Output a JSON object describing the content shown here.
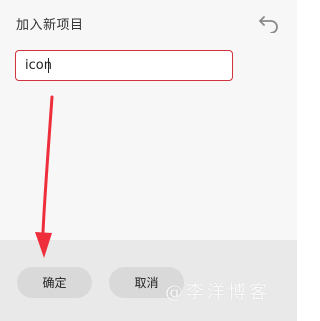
{
  "dialog": {
    "title": "加入新项目",
    "undo_icon": "undo-icon",
    "input_value": "icon",
    "ok_label": "确定",
    "cancel_label": "取消",
    "watermark": "@李洋博客"
  },
  "colors": {
    "input_border": "#d2343f",
    "arrow": "#ee2f3b",
    "footer_bg": "#e9e9e9",
    "button_bg": "#d9d9d9"
  }
}
